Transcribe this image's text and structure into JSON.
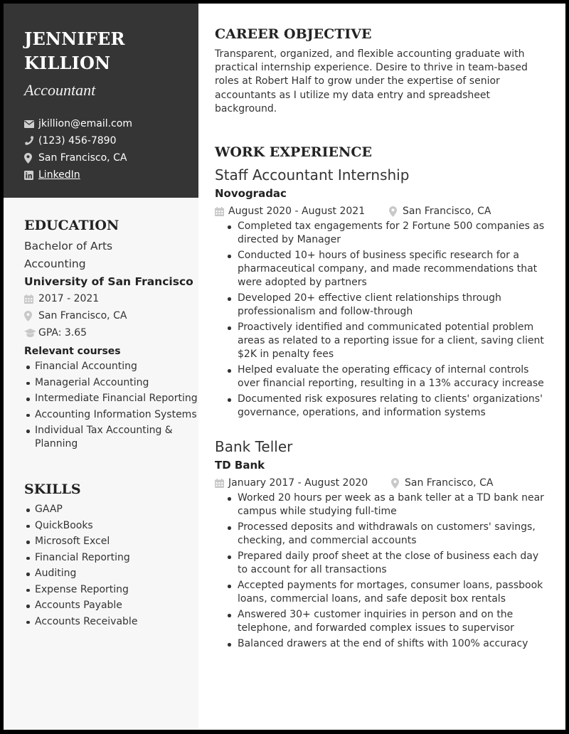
{
  "header": {
    "name_line1": "JENNIFER",
    "name_line2": "KILLION",
    "title": "Accountant"
  },
  "contact": {
    "email": {
      "icon": "envelope-icon",
      "text": "jkillion@email.com"
    },
    "phone": {
      "icon": "phone-icon",
      "text": "(123) 456-7890"
    },
    "location": {
      "icon": "map-pin-icon",
      "text": "San Francisco, CA"
    },
    "linkedin": {
      "icon": "linkedin-icon",
      "text": "LinkedIn"
    }
  },
  "education": {
    "heading": "EDUCATION",
    "degree": "Bachelor of Arts",
    "major": "Accounting",
    "school": "University of San Francisco",
    "dates": "2017 - 2021",
    "location": "San Francisco, CA",
    "gpa": "GPA: 3.65",
    "courses_label": "Relevant courses",
    "courses": [
      "Financial Accounting",
      "Managerial Accounting",
      "Intermediate Financial Reporting",
      "Accounting Information Systems",
      "Individual Tax Accounting & Planning"
    ]
  },
  "skills": {
    "heading": "SKILLS",
    "items": [
      "GAAP",
      "QuickBooks",
      "Microsoft Excel",
      "Financial Reporting",
      "Auditing",
      "Expense Reporting",
      "Accounts Payable",
      "Accounts Receivable"
    ]
  },
  "objective": {
    "heading": "CAREER OBJECTIVE",
    "text": "Transparent, organized, and flexible accounting graduate with practical internship experience. Desire to thrive in team-based roles at Robert Half to grow under the expertise of senior accountants as I utilize my data entry and spreadsheet background."
  },
  "work": {
    "heading": "WORK EXPERIENCE",
    "jobs": [
      {
        "title": "Staff Accountant Internship",
        "company": "Novogradac",
        "dates": "August 2020 - August 2021",
        "location": "San Francisco, CA",
        "bullets": [
          "Completed tax engagements for 2 Fortune 500 companies as directed by Manager",
          "Conducted 10+ hours of business specific research for a pharmaceutical company, and made recommendations that were adopted by partners",
          "Developed 20+ effective client relationships through professionalism and follow-through",
          "Proactively identified and communicated potential problem areas as related to a reporting issue for a client, saving client $2K in penalty fees",
          "Helped evaluate the operating efficacy of internal controls over financial reporting, resulting in a 13% accuracy increase",
          "Documented risk exposures relating to clients' organizations' governance, operations, and information systems"
        ]
      },
      {
        "title": "Bank Teller",
        "company": "TD Bank",
        "dates": "January 2017 - August 2020",
        "location": "San Francisco, CA",
        "bullets": [
          "Worked 20 hours per week as a bank teller at a TD bank near campus while studying full-time",
          "Processed deposits and withdrawals on customers' savings, checking, and commercial accounts",
          "Prepared daily proof sheet at the close of business each day to account for all transactions",
          "Accepted payments for mortages, consumer loans, passbook loans, commercial loans, and safe deposit box rentals",
          "Answered 30+ customer inquiries in person and on the telephone, and forwarded complex issues to supervisor",
          "Balanced drawers at the end of shifts with 100% accuracy"
        ]
      }
    ]
  },
  "colors": {
    "sidebar_header_bg": "#353535",
    "sidebar_bg": "#f7f7f7",
    "icon_gray": "#c8c8c8",
    "text": "#333333"
  }
}
